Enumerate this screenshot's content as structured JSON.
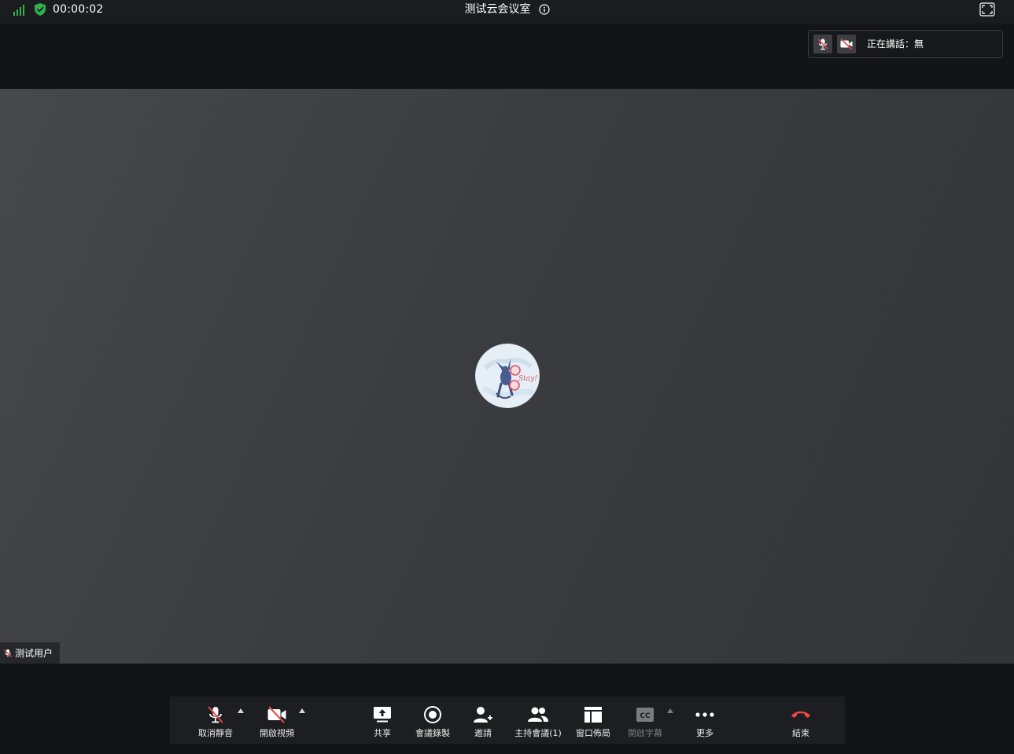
{
  "topbar": {
    "timer": "00:00:02",
    "title": "测试云会议室",
    "signal_icon": "signal-bars-icon",
    "security_icon": "shield-check-icon",
    "info_icon": "info-icon",
    "fullscreen_icon": "fullscreen-icon",
    "colors": {
      "signal": "#2eb34e",
      "shield": "#2eb34e"
    }
  },
  "speaking_panel": {
    "label": "正在講話：無",
    "mic_icon": "mic-muted-icon",
    "camera_icon": "camera-off-icon"
  },
  "stage": {
    "avatar_icon": "user-avatar",
    "avatar_text": "Stay!",
    "participant": {
      "name": "测试用户",
      "mic_icon": "mic-muted-icon"
    }
  },
  "toolbar": {
    "items": [
      {
        "label": "取消靜音",
        "icon": "mic-muted-icon",
        "has_menu": true
      },
      {
        "label": "開啟視頻",
        "icon": "camera-off-icon",
        "has_menu": true
      },
      {
        "label": "共享",
        "icon": "share-screen-icon"
      },
      {
        "label": "會議錄製",
        "icon": "record-icon"
      },
      {
        "label": "邀請",
        "icon": "invite-user-icon"
      },
      {
        "label": "主持會議(1)",
        "icon": "participants-icon"
      },
      {
        "label": "窗口佈局",
        "icon": "layout-icon"
      },
      {
        "label": "開啟字幕",
        "icon": "captions-icon",
        "disabled": true,
        "has_menu": true
      },
      {
        "label": "更多",
        "icon": "more-icon"
      },
      {
        "label": "結束",
        "icon": "hang-up-icon"
      }
    ],
    "colors": {
      "muted_slash": "#e5484d",
      "end_call": "#f0434a",
      "icon": "#ffffff",
      "disabled": "#7a7b7e"
    }
  }
}
